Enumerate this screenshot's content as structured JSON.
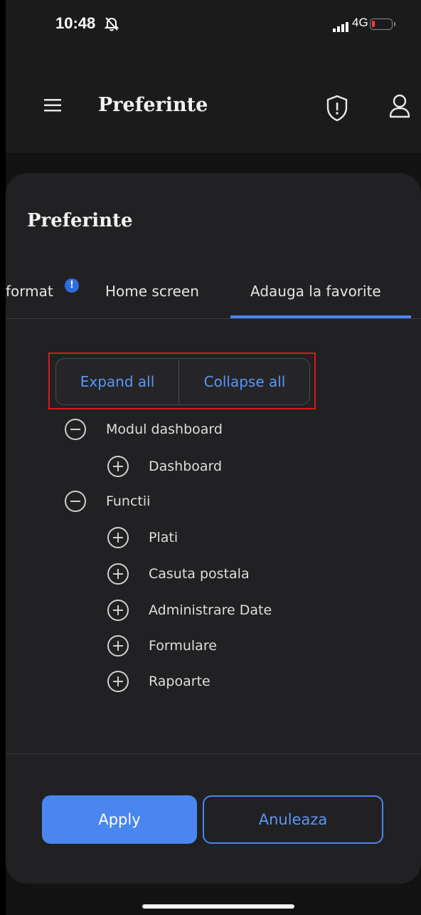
{
  "status_bar": {
    "time": "10:48",
    "network": "4G"
  },
  "app_bar": {
    "title": "Preferinte"
  },
  "sheet": {
    "title": "Preferinte",
    "tabs": [
      {
        "label": "format",
        "badge": "!"
      },
      {
        "label": "Home screen"
      },
      {
        "label": "Adauga la favorite",
        "active": true
      }
    ],
    "segmented": {
      "expand_label": "Expand all",
      "collapse_label": "Collapse all"
    },
    "tree": [
      {
        "label": "Modul dashboard",
        "state": "expanded",
        "level": 0
      },
      {
        "label": "Dashboard",
        "state": "collapsed",
        "level": 1
      },
      {
        "label": "Functii",
        "state": "expanded",
        "level": 0
      },
      {
        "label": "Plati",
        "state": "collapsed",
        "level": 1
      },
      {
        "label": "Casuta postala",
        "state": "collapsed",
        "level": 1
      },
      {
        "label": "Administrare Date",
        "state": "collapsed",
        "level": 1
      },
      {
        "label": "Formulare",
        "state": "collapsed",
        "level": 1
      },
      {
        "label": "Rapoarte",
        "state": "collapsed",
        "level": 1
      }
    ],
    "actions": {
      "apply_label": "Apply",
      "cancel_label": "Anuleaza"
    }
  },
  "colors": {
    "accent": "#4a86f0",
    "highlight": "#d71920",
    "background": "#212123"
  }
}
